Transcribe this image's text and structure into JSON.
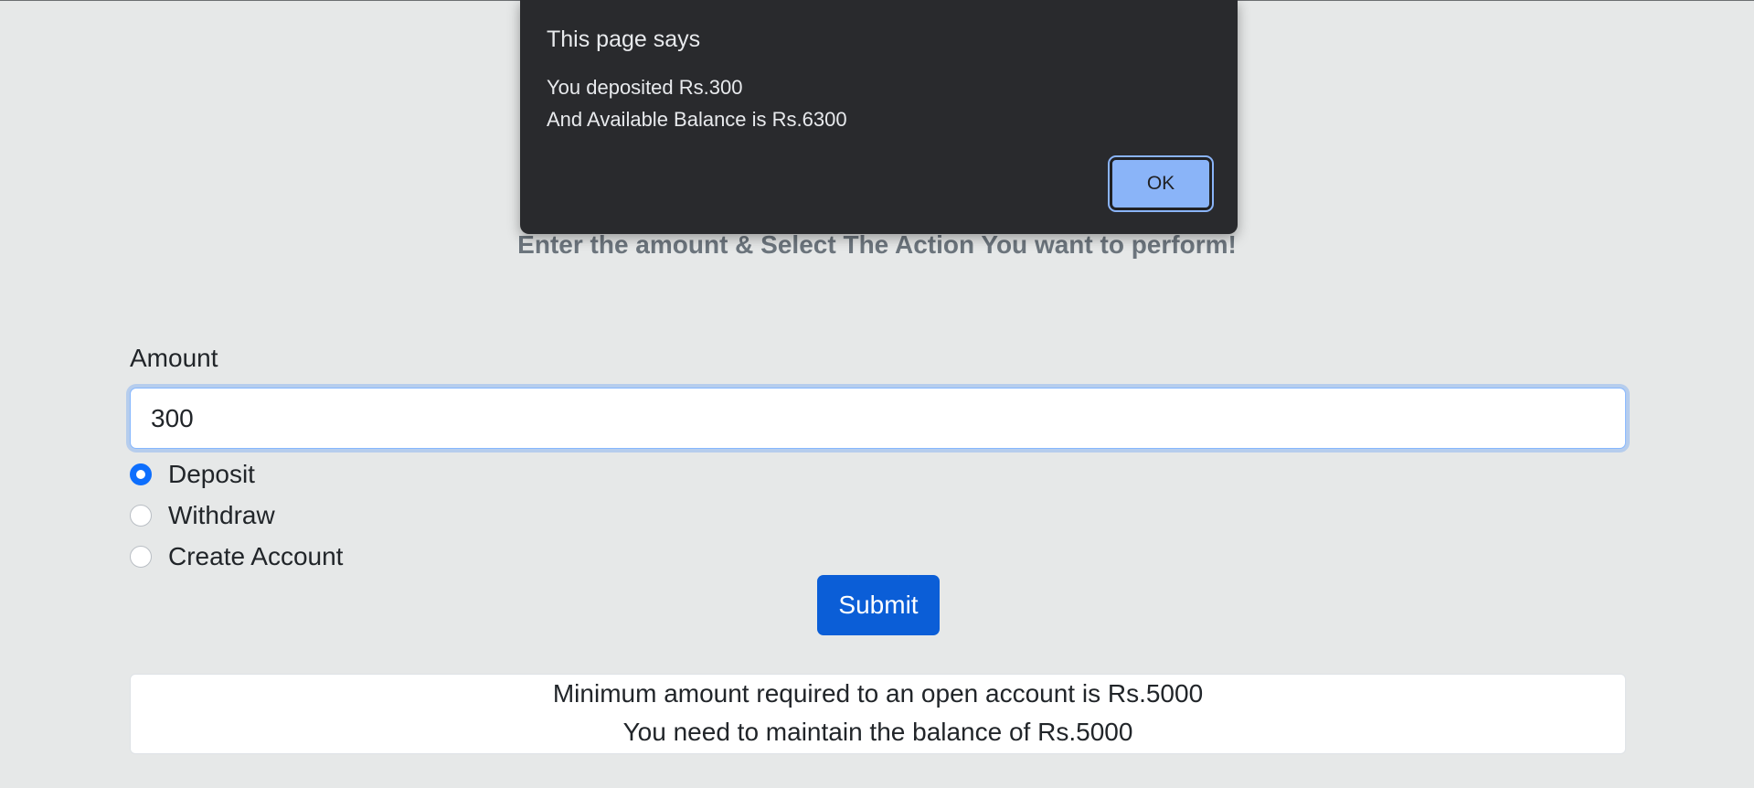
{
  "page": {
    "subtitle": "Enter the amount & Select The Action You want to perform!"
  },
  "form": {
    "amount_label": "Amount",
    "amount_value": "300",
    "options": [
      {
        "label": "Deposit",
        "checked": true
      },
      {
        "label": "Withdraw",
        "checked": false
      },
      {
        "label": "Create Account",
        "checked": false
      }
    ],
    "submit_label": "Submit"
  },
  "info": {
    "line1": "Minimum amount required to an open account is Rs.5000",
    "line2": "You need to maintain the balance of Rs.5000"
  },
  "dialog": {
    "title": "This page says",
    "message_line1": "You deposited Rs.300",
    "message_line2": "And Available Balance is Rs.6300",
    "ok_label": "OK"
  },
  "colors": {
    "primary": "#0b5ed7",
    "dialog_bg": "#292a2d",
    "dialog_button": "#8ab4f8",
    "page_bg": "#e6e8e8"
  }
}
